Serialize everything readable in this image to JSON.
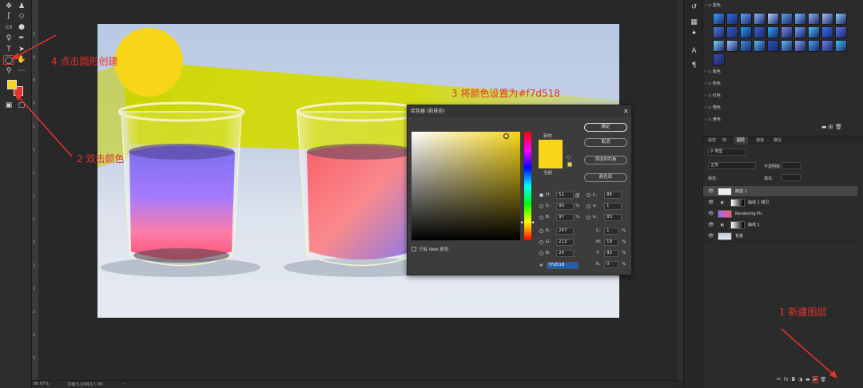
{
  "toolbar": {
    "tools": [
      "move-icon",
      "artboard-icon",
      "lasso-icon",
      "magic-wand-icon",
      "eraser-icon",
      "gradient-icon",
      "blur-icon",
      "pen-icon",
      "type-icon",
      "path-select-icon",
      "ellipse-icon",
      "hand-icon",
      "zoom-icon",
      "more-icon"
    ]
  },
  "ruler": {
    "marks": [
      "2",
      "4",
      "6",
      "8",
      "1",
      "1",
      "1",
      "1",
      "1",
      "2",
      "2",
      "2",
      "2",
      "2",
      "3"
    ]
  },
  "status": {
    "zoom": "86.67%",
    "doc_info": "文档:5.93M/17.7M"
  },
  "colors": {
    "foreground": "#f7d518",
    "background": "#e8322a",
    "annotation": "#e8322a"
  },
  "gradients_panel": {
    "folders": [
      {
        "label": "蓝色",
        "open": true
      },
      {
        "label": "紫色"
      },
      {
        "label": "粉色"
      },
      {
        "label": "红色"
      },
      {
        "label": "橙色"
      },
      {
        "label": "黄色"
      }
    ],
    "swatch_colors": [
      "#3aa0ff",
      "#2f6de0",
      "#6aa5ff",
      "#8ab6ff",
      "#b7d4ff",
      "#5ea8e8",
      "#7ec0ff",
      "#8fb4f0",
      "#a6c4f6",
      "#90d0ff",
      "#4b7cde",
      "#355ad0",
      "#1f9bff",
      "#3a5fd8",
      "#2aa6ff",
      "#7a8de6",
      "#6f9df2",
      "#4cc3ff",
      "#3e6ff2",
      "#5a72e8",
      "#7ed6ff",
      "#9fc1ff",
      "#3f8fe0",
      "#5bb7f5",
      "#2c4fbf",
      "#6db4ff",
      "#8a9ff0",
      "#4aa0f0",
      "#6f7ff0",
      "#40c0ff",
      "#3a4ea8"
    ]
  },
  "layers_panel": {
    "tabs": [
      "属性",
      "库",
      "图层",
      "通道",
      "路径"
    ],
    "active_tab": "图层",
    "kind_label": "类型",
    "blend_mode": "正常",
    "opacity_label": "不透明度:",
    "lock_label": "锁定:",
    "fill_label": "填充:",
    "layers": [
      {
        "name": "椭圆 1",
        "kind": "shape",
        "selected": true
      },
      {
        "name": "曲线 1 拷贝",
        "kind": "adjustment"
      },
      {
        "name": "Rendering Pic",
        "kind": "pixel"
      },
      {
        "name": "曲线 1",
        "kind": "adjustment"
      },
      {
        "name": "背景",
        "kind": "background"
      }
    ]
  },
  "picker": {
    "title": "拾色器 (前景色)",
    "new_label": "新的",
    "current_label": "当前",
    "ok": "确定",
    "cancel": "取消",
    "add_swatch": "添加到色板",
    "libraries": "颜色库",
    "web_only": "只有 Web 颜色",
    "H": "51",
    "H_unit": "度",
    "S": "90",
    "S_unit": "%",
    "B": "97",
    "B_unit": "%",
    "R": "247",
    "G": "213",
    "Bv": "24",
    "L": "86",
    "a": "1",
    "b": "83",
    "C": "1",
    "M": "18",
    "Y": "92",
    "K": "0",
    "pct": "%",
    "hex": "f7d518",
    "hash": "#"
  },
  "annotations": {
    "step1": "1 新建图层",
    "step2": "2 双击颜色",
    "step3": "3 将颜色设置为#f7d518",
    "step4": "4 点击圆形创建"
  }
}
